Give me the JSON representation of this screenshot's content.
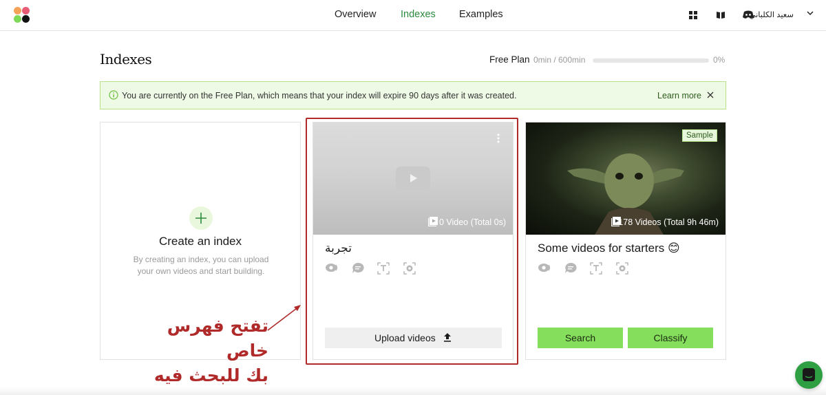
{
  "nav": {
    "links": [
      "Overview",
      "Indexes",
      "Examples"
    ],
    "active": "Indexes",
    "user_name": "سعيد الكلباني"
  },
  "colors": {
    "accent_green": "#2b8a3e",
    "button_green": "#86df5c",
    "banner_bg": "#eef9e6",
    "annotation_red": "#b02a2a"
  },
  "header": {
    "title": "Indexes",
    "plan_label": "Free Plan",
    "plan_usage": "0min / 600min",
    "plan_percent_text": "0%",
    "plan_fraction": 0
  },
  "banner": {
    "text": "You are currently on the Free Plan, which means that your index will expire 90 days after it was created.",
    "learn_more": "Learn more"
  },
  "create_card": {
    "title": "Create an index",
    "description": "By creating an index, you can upload your own videos and start building."
  },
  "index_card": {
    "name": "تجربة",
    "video_count": "0 Video (Total 0s)",
    "upload_label": "Upload videos",
    "option_icons": [
      "visual-icon",
      "conversation-icon",
      "text-in-video-icon",
      "logo-icon"
    ]
  },
  "sample_card": {
    "badge": "Sample",
    "name": "Some videos for starters 😊",
    "video_count": "178 Videos (Total 9h 46m)",
    "search_label": "Search",
    "classify_label": "Classify"
  },
  "annotation": {
    "line1": "تفتح فهرس خاص",
    "line2": "بك للبحث فيه"
  }
}
